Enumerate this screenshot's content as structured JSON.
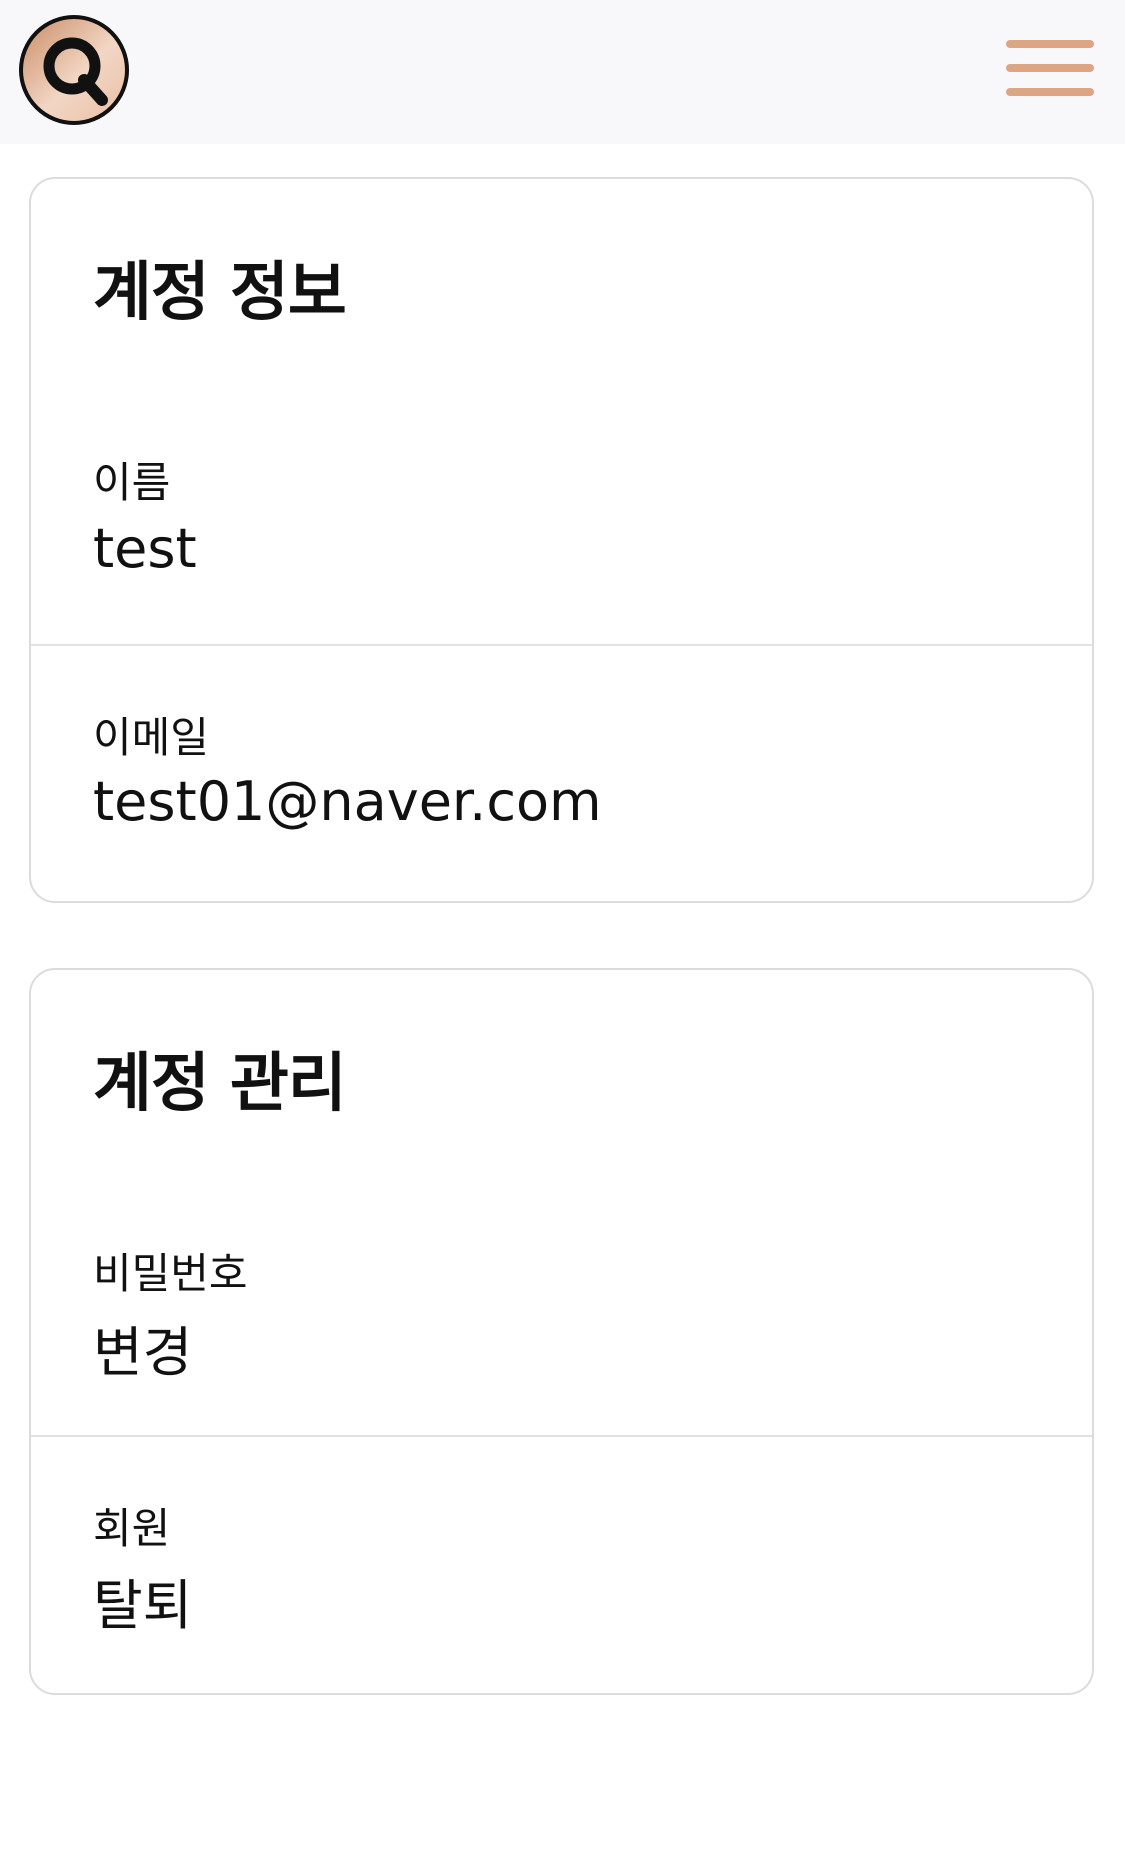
{
  "header": {
    "logo_icon": "search-logo-icon",
    "menu_icon": "hamburger-menu-icon",
    "accent_color": "#dca584"
  },
  "account_info": {
    "title": "계정 정보",
    "name_label": "이름",
    "name_value": "test",
    "email_label": "이메일",
    "email_value": "test01@naver.com"
  },
  "account_manage": {
    "title": "계정 관리",
    "password_label": "비밀번호",
    "password_action": "변경",
    "membership_label": "회원",
    "membership_action": "탈퇴"
  }
}
